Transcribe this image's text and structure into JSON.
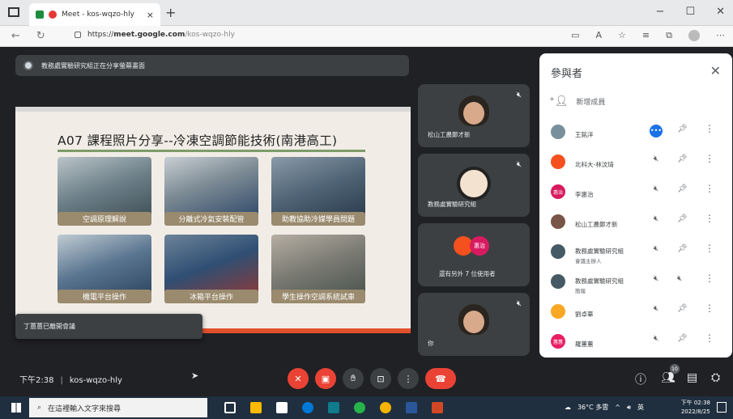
{
  "browser": {
    "tab_title": "Meet - kos-wqzo-hly",
    "tab_close": "×",
    "new_tab": "+",
    "url_scheme": "https://",
    "url_host": "meet.google.com",
    "url_path": "/kos-wqzo-hly",
    "window_controls": [
      "−",
      "☐",
      "✕"
    ]
  },
  "presentation_banner": {
    "text": "教務處實驗研究組正在分享螢幕畫面"
  },
  "slide": {
    "title": "A07 課程照片分享--冷凍空調節能技術(南港高工)",
    "captions": [
      "空調原理解說",
      "分離式冷氣安裝配管",
      "助教協助冷媒學員問題",
      "機電平台操作",
      "冰箱平台操作",
      "學生操作空調系統試車"
    ]
  },
  "toast": {
    "text": "丁蕙蕙已離開會議"
  },
  "tiles": [
    {
      "name": "松山工農鄭才新"
    },
    {
      "name": "教務處實驗研究組"
    },
    {
      "name": "還有另外 7 位使用者",
      "avatar_a": "",
      "avatar_b": "惠治"
    },
    {
      "name": "你"
    }
  ],
  "panel": {
    "title": "參與者",
    "close": "✕",
    "add_label": "新增成員",
    "participants": [
      {
        "name": "王銘洋",
        "sub": "",
        "color": "#78909c",
        "initial": ""
      },
      {
        "name": "北科大-林汶琦",
        "sub": "",
        "color": "#f4511e",
        "initial": ""
      },
      {
        "name": "李惠治",
        "sub": "",
        "color": "#d81b60",
        "initial": "惠治"
      },
      {
        "name": "松山工農鄭才新",
        "sub": "",
        "color": "#795548",
        "initial": ""
      },
      {
        "name": "教務處實驗研究組",
        "sub": "會議主辦人",
        "color": "#455a64",
        "initial": ""
      },
      {
        "name": "教務處實驗研究組",
        "sub": "簡報",
        "color": "#455a64",
        "initial": ""
      },
      {
        "name": "劉卓華",
        "sub": "",
        "color": "#f9a825",
        "initial": ""
      },
      {
        "name": "羅蕙蕙",
        "sub": "",
        "color": "#e91e63",
        "initial": "蕙蕙"
      }
    ]
  },
  "bottombar": {
    "time": "下午2:38",
    "meeting_code": "kos-wqzo-hly",
    "participants_badge": "10"
  },
  "taskbar": {
    "search_placeholder": "在這裡輸入文字來搜尋",
    "weather": "36°C 多雲",
    "ime": "英",
    "clock_time": "下午 02:38",
    "clock_date": "2022/8/25"
  },
  "colors": {
    "meet_red": "#ea4335",
    "meet_bg": "#202124",
    "tile_bg": "#3c4043",
    "slide_accent": "#e2502d"
  }
}
